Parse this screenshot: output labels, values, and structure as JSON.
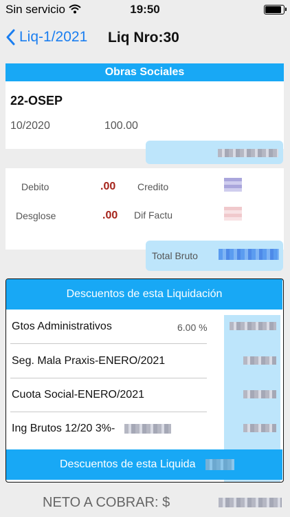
{
  "status": {
    "carrier": "Sin servicio",
    "time": "19:50"
  },
  "nav": {
    "back_label": "Liq-1/2021",
    "title": "Liq Nro:30"
  },
  "obras": {
    "header": "Obras Sociales",
    "name": "22-OSEP",
    "period": "10/2020",
    "amount": "100.00"
  },
  "summary": {
    "debito_label": "Debito",
    "debito_value": ".00",
    "credito_label": "Credito",
    "desglose_label": "Desglose",
    "desglose_value": ".00",
    "dif_label": "Dif Factu",
    "total_label": "Total Bruto"
  },
  "descuentos": {
    "header": "Descuentos de esta Liquidación",
    "footer": "Descuentos de esta Liquida",
    "rows": [
      {
        "label": "Gtos Administrativos",
        "pct": "6.00 %"
      },
      {
        "label": "Seg. Mala Praxis-ENERO/2021"
      },
      {
        "label": "Cuota Social-ENERO/2021"
      },
      {
        "label": "Ing Brutos 12/20  3%-"
      }
    ]
  },
  "neto_label": "NETO A COBRAR: $",
  "colors": {
    "accent": "#18a8f5",
    "link": "#1a7ef0",
    "negative": "#a5231a"
  }
}
